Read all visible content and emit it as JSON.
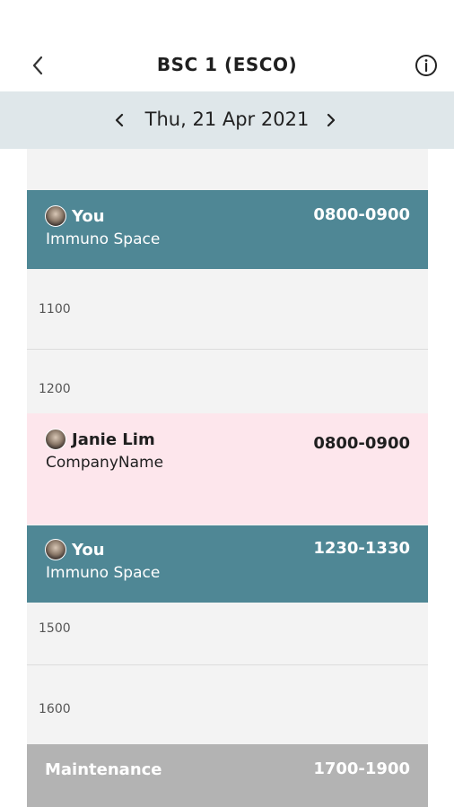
{
  "header": {
    "back_icon": "chevron-left-icon",
    "title": "BSC 1 (ESCO)",
    "info_icon": "info-circle-icon"
  },
  "date_bar": {
    "prev_icon": "chevron-left-icon",
    "date": "Thu, 21 Apr 2021",
    "next_icon": "chevron-right-icon"
  },
  "timeline": {
    "hour_labels": [
      "1100",
      "1200",
      "1500",
      "1600"
    ],
    "bookings": [
      {
        "name": "You",
        "org": "Immuno Space",
        "time": "0800-0900",
        "kind": "mine"
      },
      {
        "name": "Janie Lim",
        "org": "CompanyName",
        "time": "0800-0900",
        "kind": "other"
      },
      {
        "name": "You",
        "org": "Immuno Space",
        "time": "1230-1330",
        "kind": "mine"
      },
      {
        "name": "Maintenance",
        "org": "",
        "time": "1700-1900",
        "kind": "maintenance"
      }
    ]
  },
  "colors": {
    "mine": "#4f8795",
    "other": "#fde6ec",
    "maintenance": "#b3b3b3",
    "date_bar": "#dfe7ea",
    "timeline_bg": "#f3f3f3"
  }
}
